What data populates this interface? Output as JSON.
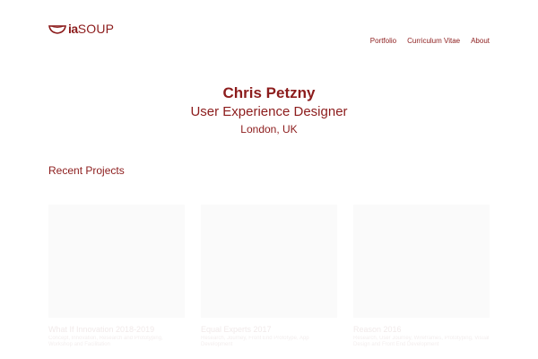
{
  "header": {
    "logo_ia": "ia",
    "logo_soup": "SOUP",
    "nav": [
      {
        "label": "Portfolio"
      },
      {
        "label": "Curriculum Vitae"
      },
      {
        "label": "About"
      }
    ]
  },
  "hero": {
    "name": "Chris Petzny",
    "role": "User Experience Designer",
    "location": "London, UK"
  },
  "projects": {
    "title": "Recent Projects",
    "items": [
      {
        "title": "What If Innovation 2018-2019",
        "description": "Concept, Innovation, Research and Prototyping, Workshop and Facilitation"
      },
      {
        "title": "Equal Experts 2017",
        "description": "Research, Journey, Front End Prototype, App Development"
      },
      {
        "title": "Reason 2016",
        "description": "Research, User Journey, Wireframes, Prototyping, Visual Design and Front End Development"
      }
    ]
  },
  "colors": {
    "brand": "#8c1c1c",
    "thumb_bg": "#fafafa"
  }
}
